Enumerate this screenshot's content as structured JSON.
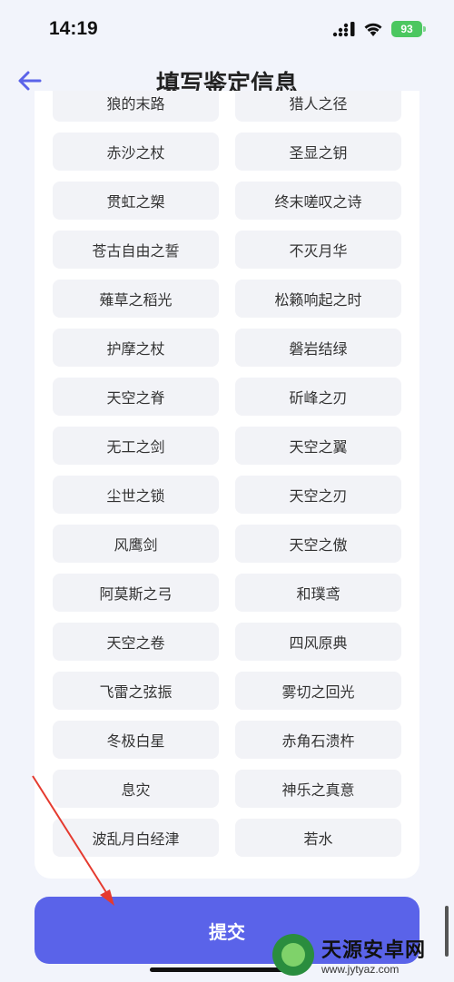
{
  "status": {
    "time": "14:19",
    "battery": "93"
  },
  "header": {
    "title": "填写鉴定信息"
  },
  "options": [
    "狼的末路",
    "猎人之径",
    "赤沙之杖",
    "圣显之钥",
    "贯虹之槊",
    "终末嗟叹之诗",
    "苍古自由之誓",
    "不灭月华",
    "薙草之稻光",
    "松籁响起之时",
    "护摩之杖",
    "磐岩结绿",
    "天空之脊",
    "斫峰之刃",
    "无工之剑",
    "天空之翼",
    "尘世之锁",
    "天空之刃",
    "风鹰剑",
    "天空之傲",
    "阿莫斯之弓",
    "和璞鸢",
    "天空之卷",
    "四风原典",
    "飞雷之弦振",
    "雾切之回光",
    "冬极白星",
    "赤角石溃杵",
    "息灾",
    "神乐之真意",
    "波乱月白经津",
    "若水"
  ],
  "submit_label": "提交",
  "watermark": {
    "title": "天源安卓网",
    "url": "www.jytyaz.com"
  },
  "colors": {
    "accent": "#5a63e9",
    "background": "#f2f4fb",
    "option_bg": "#f2f3f7",
    "battery": "#4cc760",
    "annotation_arrow": "#e53a2f"
  }
}
